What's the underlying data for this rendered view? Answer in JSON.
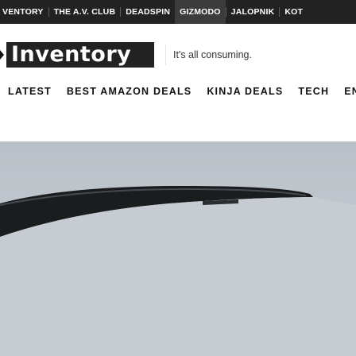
{
  "top_nav": {
    "items": [
      "VENTORY",
      "THE A.V. CLUB",
      "DEADSPIN",
      "GIZMODO",
      "JALOPNIK",
      "KOT"
    ],
    "active_index": 3
  },
  "brand": {
    "logo": "Inventory",
    "tagline": "It's all consuming."
  },
  "sub_nav": {
    "items": [
      "LATEST",
      "BEST AMAZON DEALS",
      "KINJA DEALS",
      "TECH",
      "EN"
    ]
  },
  "colors": {
    "top_nav_bg": "#222222",
    "logo_bg": "#222222",
    "hero_bg": "#c2c9cf"
  }
}
